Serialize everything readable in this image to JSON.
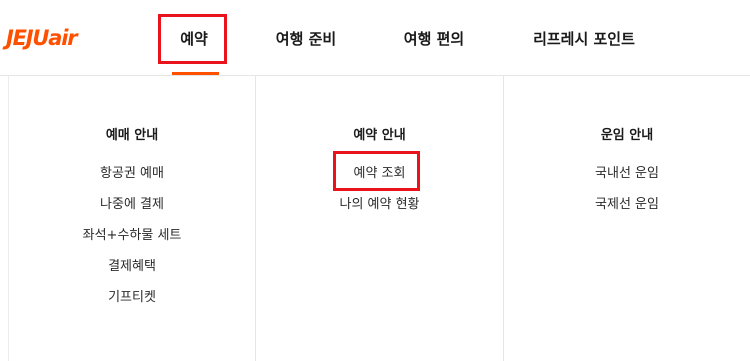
{
  "header": {
    "logo_text": "JEJUair",
    "nav": [
      {
        "label": "예약"
      },
      {
        "label": "여행 준비"
      },
      {
        "label": "여행 편의"
      },
      {
        "label": "리프레시 포인트"
      }
    ]
  },
  "menu": {
    "columns": [
      {
        "title": "예매 안내",
        "links": [
          "항공권 예매",
          "나중에 결제",
          "좌석+수하물 세트",
          "결제혜택",
          "기프티켓"
        ]
      },
      {
        "title": "예약 안내",
        "links": [
          "예약 조회",
          "나의 예약 현황"
        ]
      },
      {
        "title": "운임 안내",
        "links": [
          "국내선 운임",
          "국제선 운임"
        ]
      }
    ]
  },
  "colors": {
    "brand": "#ff5000",
    "highlight": "#e8131b",
    "divider": "#e6e6e6"
  }
}
